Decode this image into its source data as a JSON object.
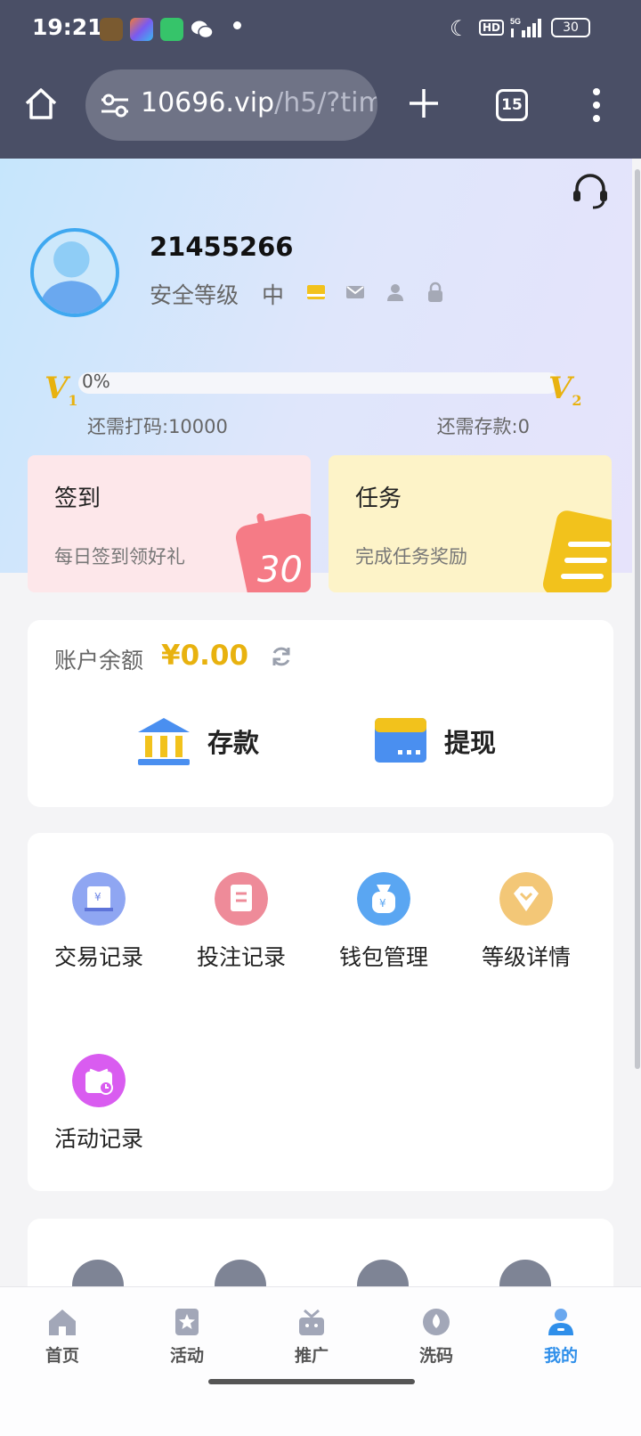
{
  "status_bar": {
    "time": "19:21",
    "hd_label": "HD",
    "network": "5G",
    "battery": "30"
  },
  "browser": {
    "url_host": "10696.vip",
    "url_path": "/h5/?tim",
    "tab_count": "15"
  },
  "profile": {
    "username": "21455266",
    "security_label": "安全等级",
    "security_value": "中",
    "security_icons": [
      "card-icon",
      "mail-icon",
      "user-icon",
      "lock-icon"
    ]
  },
  "vip": {
    "current_level": "V",
    "current_level_num": "1",
    "next_level": "V",
    "next_level_num": "2",
    "progress_percent": 0,
    "progress_text": "0%",
    "need_bet": "还需打码:10000",
    "need_deposit": "还需存款:0"
  },
  "cards": {
    "signin": {
      "title": "签到",
      "subtitle": "每日签到领好礼",
      "deco_text": "30"
    },
    "task": {
      "title": "任务",
      "subtitle": "完成任务奖励"
    }
  },
  "balance": {
    "label": "账户余额",
    "value": "¥0.00",
    "deposit_label": "存款",
    "withdraw_label": "提现"
  },
  "menu": [
    {
      "label": "交易记录",
      "icon": "receipt-icon",
      "color": "#7f9cf0"
    },
    {
      "label": "投注记录",
      "icon": "document-icon",
      "color": "#ee8b99"
    },
    {
      "label": "钱包管理",
      "icon": "wallet-icon",
      "color": "#5aa6f2"
    },
    {
      "label": "等级详情",
      "icon": "diamond-icon",
      "color": "#f3c777"
    },
    {
      "label": "活动记录",
      "icon": "gift-icon",
      "color": "#d95cf0"
    }
  ],
  "bottom_nav": [
    {
      "label": "首页",
      "icon": "home-icon"
    },
    {
      "label": "活动",
      "icon": "star-icon"
    },
    {
      "label": "推广",
      "icon": "gift-icon"
    },
    {
      "label": "洗码",
      "icon": "drop-icon"
    },
    {
      "label": "我的",
      "icon": "profile-icon",
      "active": true
    }
  ],
  "colors": {
    "accent": "#2f8fea",
    "gold": "#e8b20f",
    "chrome": "#4a4f66"
  }
}
